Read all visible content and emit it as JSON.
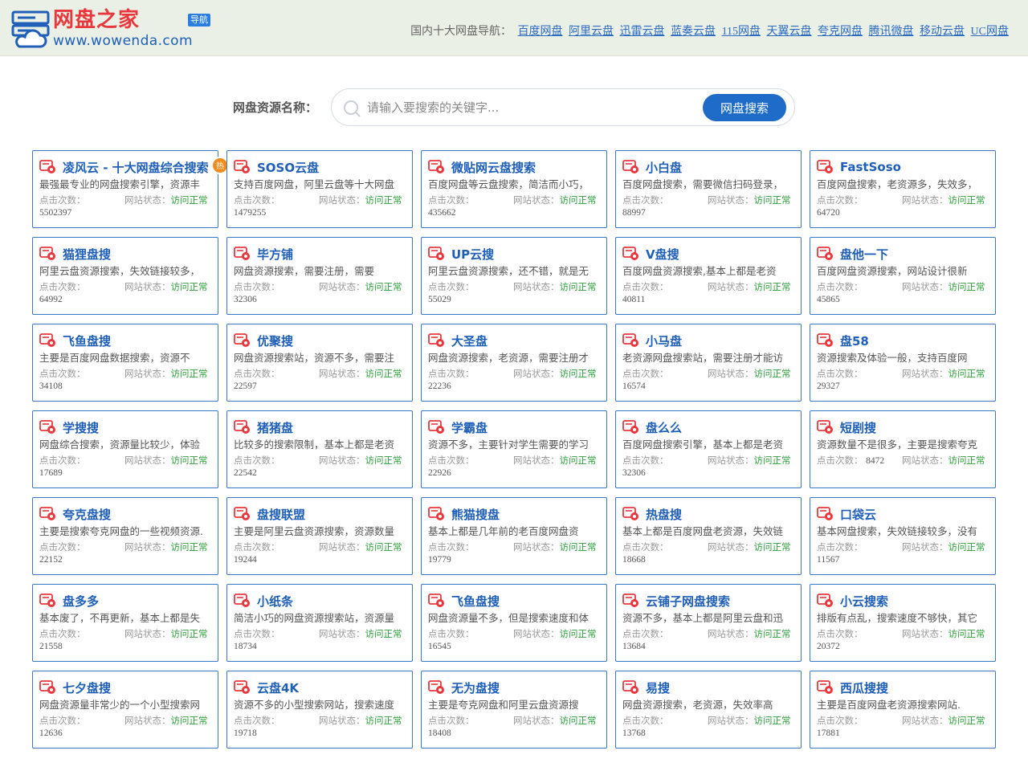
{
  "header": {
    "logo_title": "网盘之家",
    "logo_tag": "导航",
    "logo_url": "www.wowenda.com",
    "nav_label": "国内十大网盘导航：",
    "nav_links": [
      "百度网盘",
      "阿里云盘",
      "迅雷云盘",
      "蓝奏云盘",
      "115网盘",
      "天翼云盘",
      "夸克网盘",
      "腾讯微盘",
      "移动云盘",
      "UC网盘"
    ]
  },
  "search": {
    "label": "网盘资源名称：",
    "placeholder": "请输入要搜索的关键字...",
    "button": "网盘搜索"
  },
  "meta_labels": {
    "clicks": "点击次数：",
    "status": "网站状态：",
    "status_value": "访问正常"
  },
  "hot_badge": "热",
  "cards": [
    {
      "title": "凌风云 - 十大网盘综合搜索",
      "desc": "最强最专业的网盘搜索引擎，资源丰",
      "clicks": "5502397"
    },
    {
      "title": "SOSO云盘",
      "desc": "支持百度网盘，阿里云盘等十大网盘",
      "clicks": "1479255"
    },
    {
      "title": "微贴网云盘搜索",
      "desc": "百度网盘等云盘搜索，简洁而小巧，",
      "clicks": "435662"
    },
    {
      "title": "小白盘",
      "desc": "百度网盘搜索，需要微信扫码登录，",
      "clicks": "88997"
    },
    {
      "title": "FastSoso",
      "desc": "百度网盘搜索，老资源多，失效多，",
      "clicks": "64720"
    },
    {
      "title": "猫狸盘搜",
      "desc": "阿里云盘资源搜索，失效链接较多，",
      "clicks": "64992"
    },
    {
      "title": "毕方铺",
      "desc": "网盘资源搜索，需要注册，需要",
      "clicks": "32306"
    },
    {
      "title": "UP云搜",
      "desc": "阿里云盘资源搜索，还不错，就是无",
      "clicks": "55029"
    },
    {
      "title": "V盘搜",
      "desc": "百度网盘资源搜索,基本上都是老资",
      "clicks": "40811"
    },
    {
      "title": "盘他一下",
      "desc": "百度网盘资源搜索，网站设计很新",
      "clicks": "45865"
    },
    {
      "title": "飞鱼盘搜",
      "desc": "主要是百度网盘数据搜索，资源不",
      "clicks": "34108"
    },
    {
      "title": "优聚搜",
      "desc": "网盘资源搜索站，资源不多，需要注",
      "clicks": "22597"
    },
    {
      "title": "大圣盘",
      "desc": "网盘资源搜索，老资源，需要注册才",
      "clicks": "22236"
    },
    {
      "title": "小马盘",
      "desc": "老资源网盘搜索站，需要注册才能访",
      "clicks": "16574"
    },
    {
      "title": "盘58",
      "desc": "资源搜索及体验一般，支持百度网",
      "clicks": "29327"
    },
    {
      "title": "学搜搜",
      "desc": "网盘综合搜索，资源量比较少，体验",
      "clicks": "17689"
    },
    {
      "title": "猪猪盘",
      "desc": "比较多的搜索限制，基本上都是老资",
      "clicks": "22542"
    },
    {
      "title": "学霸盘",
      "desc": "资源不多，主要针对学生需要的学习",
      "clicks": "22926"
    },
    {
      "title": "盘么么",
      "desc": "百度网盘搜索引擎，基本上都是老资",
      "clicks": "32306"
    },
    {
      "title": "短剧搜",
      "desc": "资源数量不是很多，主要是搜索夸克",
      "clicks": "8472"
    },
    {
      "title": "夸克盘搜",
      "desc": "主要是搜索夸克网盘的一些视频资源.",
      "clicks": "22152"
    },
    {
      "title": "盘搜联盟",
      "desc": "主要是阿里云盘资源搜索，资源数量",
      "clicks": "19244"
    },
    {
      "title": "熊猫搜盘",
      "desc": "基本上都是几年前的老百度网盘资",
      "clicks": "19779"
    },
    {
      "title": "热盘搜",
      "desc": "基本上都是百度网盘老资源，失效链",
      "clicks": "18668"
    },
    {
      "title": "口袋云",
      "desc": "基本网盘搜索，失效链接较多，没有",
      "clicks": "11567"
    },
    {
      "title": "盘多多",
      "desc": "基本废了，不再更新，基本上都是失",
      "clicks": "21558"
    },
    {
      "title": "小纸条",
      "desc": "简洁小巧的网盘资源搜索站，资源量",
      "clicks": "18734"
    },
    {
      "title": "飞鱼盘搜",
      "desc": "网盘资源量不多，但是搜索速度和体",
      "clicks": "16545"
    },
    {
      "title": "云铺子网盘搜索",
      "desc": "资源不多，基本上都是阿里云盘和迅",
      "clicks": "13684"
    },
    {
      "title": "小云搜索",
      "desc": "排版有点乱，搜索速度不够快，其它",
      "clicks": "20372"
    },
    {
      "title": "七夕盘搜",
      "desc": "网盘资源量非常少的一个小型搜索网",
      "clicks": "12636"
    },
    {
      "title": "云盘4K",
      "desc": "资源不多的小型搜索网站，搜索速度",
      "clicks": "19718"
    },
    {
      "title": "无为盘搜",
      "desc": "主要是夸克网盘和阿里云盘资源搜",
      "clicks": "18408"
    },
    {
      "title": "易搜",
      "desc": "网盘资源搜索，老资源，失效率高",
      "clicks": "13768"
    },
    {
      "title": "西瓜搜搜",
      "desc": "主要是百度网盘老资源搜索网站.",
      "clicks": "17881"
    }
  ]
}
